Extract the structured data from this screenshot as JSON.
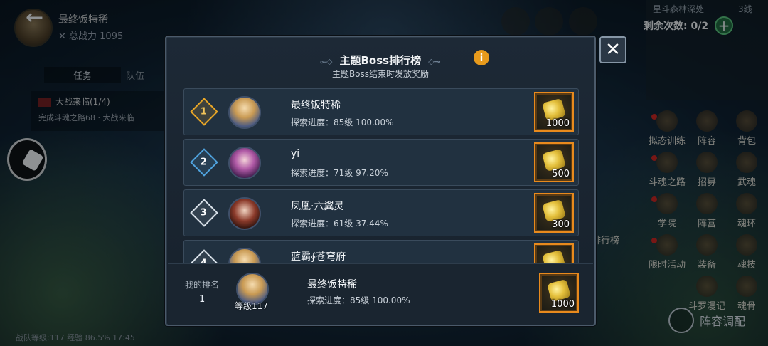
{
  "background": {
    "hud_name": "最终饭特稀",
    "hud_power": "✕ 总战力 1095",
    "tabs": [
      "任务",
      "队伍"
    ],
    "quest_title": "大战来临(1/4)",
    "quest_desc": "完成斗魂之路68 · 大战来临",
    "bottom_status": "战队等级:117    经验 86.5%        17:45",
    "map_title": "星斗森林深处",
    "map_line": "3线",
    "remain_label": "剩余次数: 0/2",
    "menu": [
      "拟态训练",
      "阵容",
      "背包",
      "斗魂之路",
      "招募",
      "武魂",
      "学院",
      "阵营",
      "魂环",
      "限时活动",
      "装备",
      "魂技",
      "斗罗漫记",
      "魂骨"
    ],
    "rank_side_label": "排行榜",
    "formation_label": "阵容调配"
  },
  "modal": {
    "title": "主题Boss排行榜",
    "subtitle": "主题Boss结束时发放奖励",
    "info_icon": "i",
    "close_icon": "✕",
    "rows": [
      {
        "rank": "1",
        "name": "最终饭特稀",
        "progress": "探索进度：85级 100.00%",
        "reward_qty": "1000"
      },
      {
        "rank": "2",
        "name": "yi",
        "progress": "探索进度：71级 97.20%",
        "reward_qty": "500"
      },
      {
        "rank": "3",
        "name": "凤凰·六翼灵",
        "progress": "探索进度：61级 37.44%",
        "reward_qty": "300"
      },
      {
        "rank": "4",
        "name": "蓝霸∮苍穹府",
        "progress": "",
        "reward_qty": ""
      }
    ],
    "my_rank": {
      "label": "我的排名",
      "rank": "1",
      "level": "等级117",
      "name": "最终饭特稀",
      "progress": "探索进度：85级 100.00%",
      "reward_qty": "1000"
    }
  },
  "colors": {
    "gold_rank": "#e8a627",
    "silver_rank": "#4fa2dd",
    "bronze_rank": "#d8e0e8",
    "reward_border": "#e88a1d",
    "info_orange": "#e79a1c"
  }
}
